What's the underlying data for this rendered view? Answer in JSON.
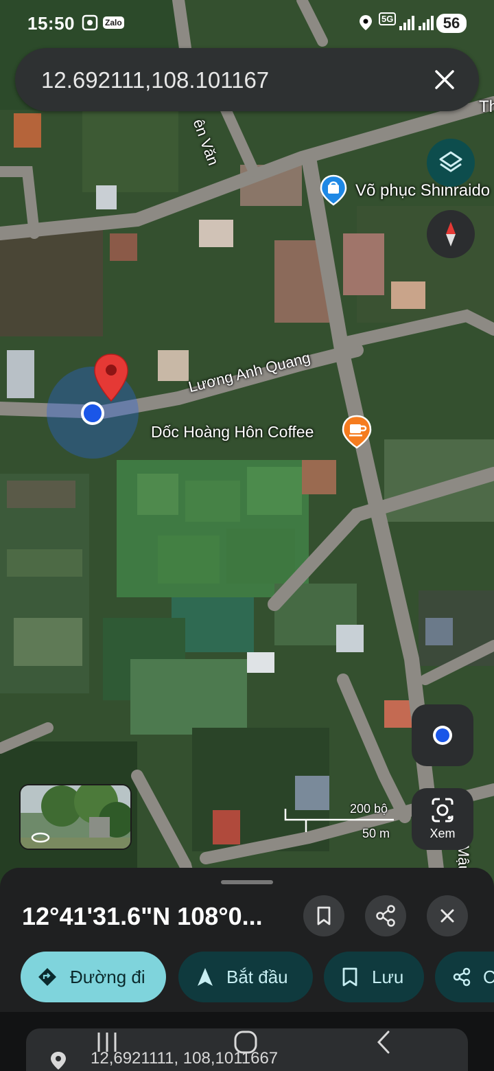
{
  "status_bar": {
    "time": "15:50",
    "zalo_label": "Zalo",
    "network_label": "5G",
    "battery": "56"
  },
  "search": {
    "query": "12.692111,108.101167"
  },
  "map": {
    "labels": {
      "street_top": "ên Văn",
      "street_right_top": "Th",
      "poi_shop": "Võ phục Shinraido",
      "street_main": "Lương Anh Quang",
      "poi_coffee": "Dốc Hoàng Hôn Coffee",
      "street_right_bottom": "Mậu"
    },
    "scale": {
      "feet": "200 bộ",
      "meters": "50 m"
    },
    "buttons": {
      "lens_label": "Xem"
    }
  },
  "place_sheet": {
    "title": "12°41'31.6\"N 108°0...",
    "actions": [
      {
        "label": "Đường đi",
        "icon": "directions-icon"
      },
      {
        "label": "Bắt đầu",
        "icon": "navigation-arrow-icon"
      },
      {
        "label": "Lưu",
        "icon": "bookmark-icon"
      },
      {
        "label": "C",
        "icon": "share-icon"
      }
    ]
  },
  "nav_bar": {
    "bottom_coords": "12,6921111, 108,1011667"
  },
  "colors": {
    "primary_chip": "#7fd4dc",
    "secondary_chip": "#0f3a3e",
    "pin_red": "#e53935",
    "location_blue": "#1a56e8"
  }
}
